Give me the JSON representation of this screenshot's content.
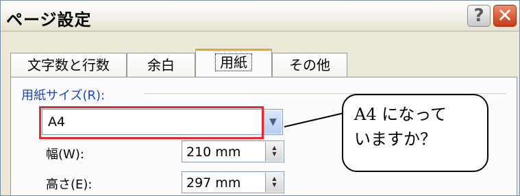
{
  "window": {
    "title": "ページ設定",
    "help_label": "?",
    "close_label": "✕"
  },
  "tabs": [
    {
      "label": "文字数と行数",
      "active": false
    },
    {
      "label": "余白",
      "active": false
    },
    {
      "label": "用紙",
      "active": true
    },
    {
      "label": "その他",
      "active": false
    }
  ],
  "paper_size": {
    "group_label": "用紙サイズ(R):",
    "selected_value": "A4",
    "dropdown_icon": "chevron-down-icon"
  },
  "width_field": {
    "label": "幅(W):",
    "value": "210 mm"
  },
  "height_field": {
    "label": "高さ(E):",
    "value": "297 mm"
  },
  "callout": {
    "line1": "A4 になって",
    "line2": "いますか？"
  },
  "colors": {
    "highlight": "#e8282a",
    "active_tab_accent": "#f3a12f",
    "group_label": "#1a44c9"
  }
}
